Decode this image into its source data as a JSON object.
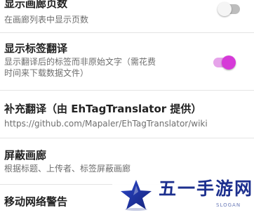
{
  "settings": {
    "gallery_page_count": {
      "title": "显示画廊页数",
      "subtitle": "在画廊列表中显示页数",
      "enabled": false
    },
    "tag_translation": {
      "title": "显示标签翻译",
      "subtitle_line1": "显示翻译后的标签而非原始文字（需花费",
      "subtitle_line2": "时间来下载数据文件）",
      "enabled": true
    },
    "extra_translation": {
      "title": "补充翻译（由 EhTagTranslator 提供）",
      "subtitle": "https://github.com/Mapaler/EhTagTranslator/wiki"
    },
    "block_gallery": {
      "title": "屏蔽画廊",
      "subtitle": "根据标题、上传者、标签屏蔽画廊"
    },
    "mobile_network_warning": {
      "title": "移动网络警告"
    }
  },
  "watermark": {
    "text": "五一手游网",
    "slogan": "SLOGAN",
    "icon": "star-logo-icon"
  },
  "colors": {
    "toggle_on_knob": "#d63ad8",
    "toggle_on_track": "#e6a3ea",
    "toggle_off_track": "#bdbdbd",
    "watermark_text": "#1c2f8e"
  }
}
